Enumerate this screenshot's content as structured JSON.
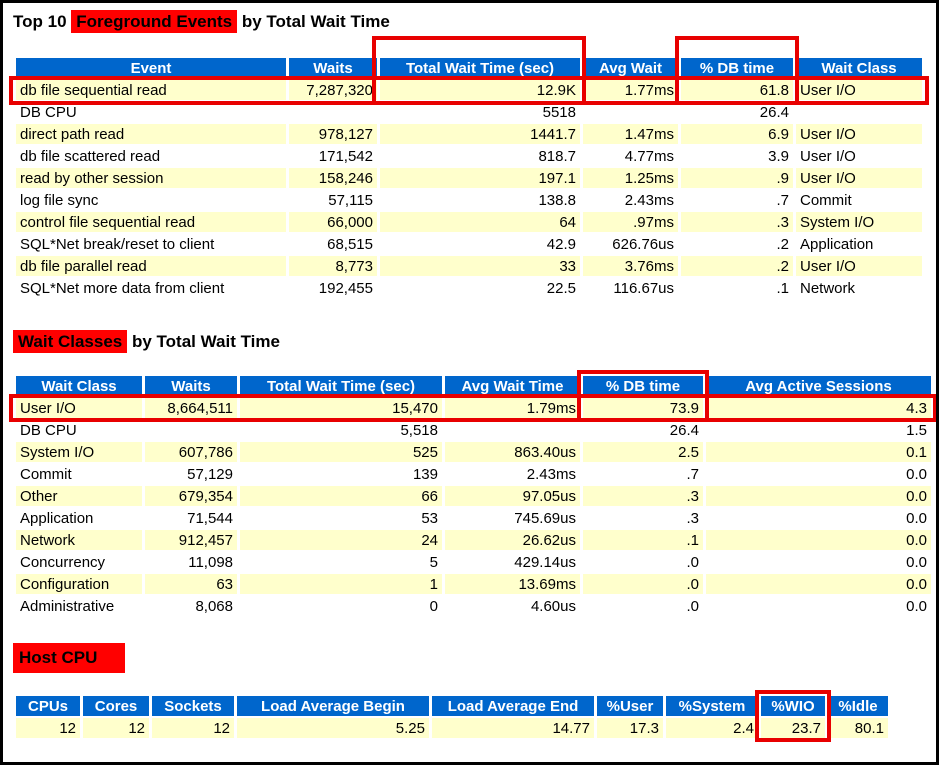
{
  "colors": {
    "header_bg": "#0066CC",
    "header_text": "#FFFFFF",
    "row_alt": "#FFFFCC",
    "row_plain": "#FFFFFF",
    "text": "#000000",
    "annotation_box": "#E80000",
    "title_highlight": "#FF0000",
    "frame": "#000000"
  },
  "sections": {
    "top_events": {
      "title": {
        "prefix": "Top 10 ",
        "highlight": "Foreground Events",
        "suffix": " by Total Wait Time"
      },
      "table": {
        "headers": [
          "Event",
          "Waits",
          "Total Wait Time (sec)",
          "Avg Wait",
          "% DB time",
          "Wait Class"
        ],
        "rows": [
          [
            "db file sequential read",
            "7,287,320",
            "12.9K",
            "1.77ms",
            "61.8",
            "User I/O"
          ],
          [
            "DB CPU",
            "",
            "5518",
            "",
            "26.4",
            ""
          ],
          [
            "direct path read",
            "978,127",
            "1441.7",
            "1.47ms",
            "6.9",
            "User I/O"
          ],
          [
            "db file scattered read",
            "171,542",
            "818.7",
            "4.77ms",
            "3.9",
            "User I/O"
          ],
          [
            "read by other session",
            "158,246",
            "197.1",
            "1.25ms",
            ".9",
            "User I/O"
          ],
          [
            "log file sync",
            "57,115",
            "138.8",
            "2.43ms",
            ".7",
            "Commit"
          ],
          [
            "control file sequential read",
            "66,000",
            "64",
            ".97ms",
            ".3",
            "System I/O"
          ],
          [
            "SQL*Net break/reset to client",
            "68,515",
            "42.9",
            "626.76us",
            ".2",
            "Application"
          ],
          [
            "db file parallel read",
            "8,773",
            "33",
            "3.76ms",
            ".2",
            "User I/O"
          ],
          [
            "SQL*Net more data from client",
            "192,455",
            "22.5",
            "116.67us",
            ".1",
            "Network"
          ]
        ]
      }
    },
    "wait_classes": {
      "title": {
        "prefix": "",
        "highlight": "Wait Classes",
        "suffix": " by Total Wait Time"
      },
      "table": {
        "headers": [
          "Wait Class",
          "Waits",
          "Total Wait Time (sec)",
          "Avg Wait Time",
          "% DB time",
          "Avg Active Sessions"
        ],
        "rows": [
          [
            "User I/O",
            "8,664,511",
            "15,470",
            "1.79ms",
            "73.9",
            "4.3"
          ],
          [
            "DB CPU",
            "",
            "5,518",
            "",
            "26.4",
            "1.5"
          ],
          [
            "System I/O",
            "607,786",
            "525",
            "863.40us",
            "2.5",
            "0.1"
          ],
          [
            "Commit",
            "57,129",
            "139",
            "2.43ms",
            ".7",
            "0.0"
          ],
          [
            "Other",
            "679,354",
            "66",
            "97.05us",
            ".3",
            "0.0"
          ],
          [
            "Application",
            "71,544",
            "53",
            "745.69us",
            ".3",
            "0.0"
          ],
          [
            "Network",
            "912,457",
            "24",
            "26.62us",
            ".1",
            "0.0"
          ],
          [
            "Concurrency",
            "11,098",
            "5",
            "429.14us",
            ".0",
            "0.0"
          ],
          [
            "Configuration",
            "63",
            "1",
            "13.69ms",
            ".0",
            "0.0"
          ],
          [
            "Administrative",
            "8,068",
            "0",
            "4.60us",
            ".0",
            "0.0"
          ]
        ]
      }
    },
    "host_cpu": {
      "title": {
        "prefix": "",
        "highlight": "Host CPU",
        "suffix": ""
      },
      "table": {
        "headers": [
          "CPUs",
          "Cores",
          "Sockets",
          "Load Average Begin",
          "Load Average End",
          "%User",
          "%System",
          "%WIO",
          "%Idle"
        ],
        "rows": [
          [
            "12",
            "12",
            "12",
            "5.25",
            "14.77",
            "17.3",
            "2.4",
            "23.7",
            "80.1"
          ]
        ]
      }
    }
  },
  "annotations": {
    "box_color": "#E80000",
    "highlighted_regions": [
      "top-events-total-wait-time-column",
      "top-events-pct-db-time-column",
      "top-events-first-row",
      "wait-classes-pct-db-time-column",
      "wait-classes-first-row",
      "host-cpu-wio-column"
    ]
  }
}
